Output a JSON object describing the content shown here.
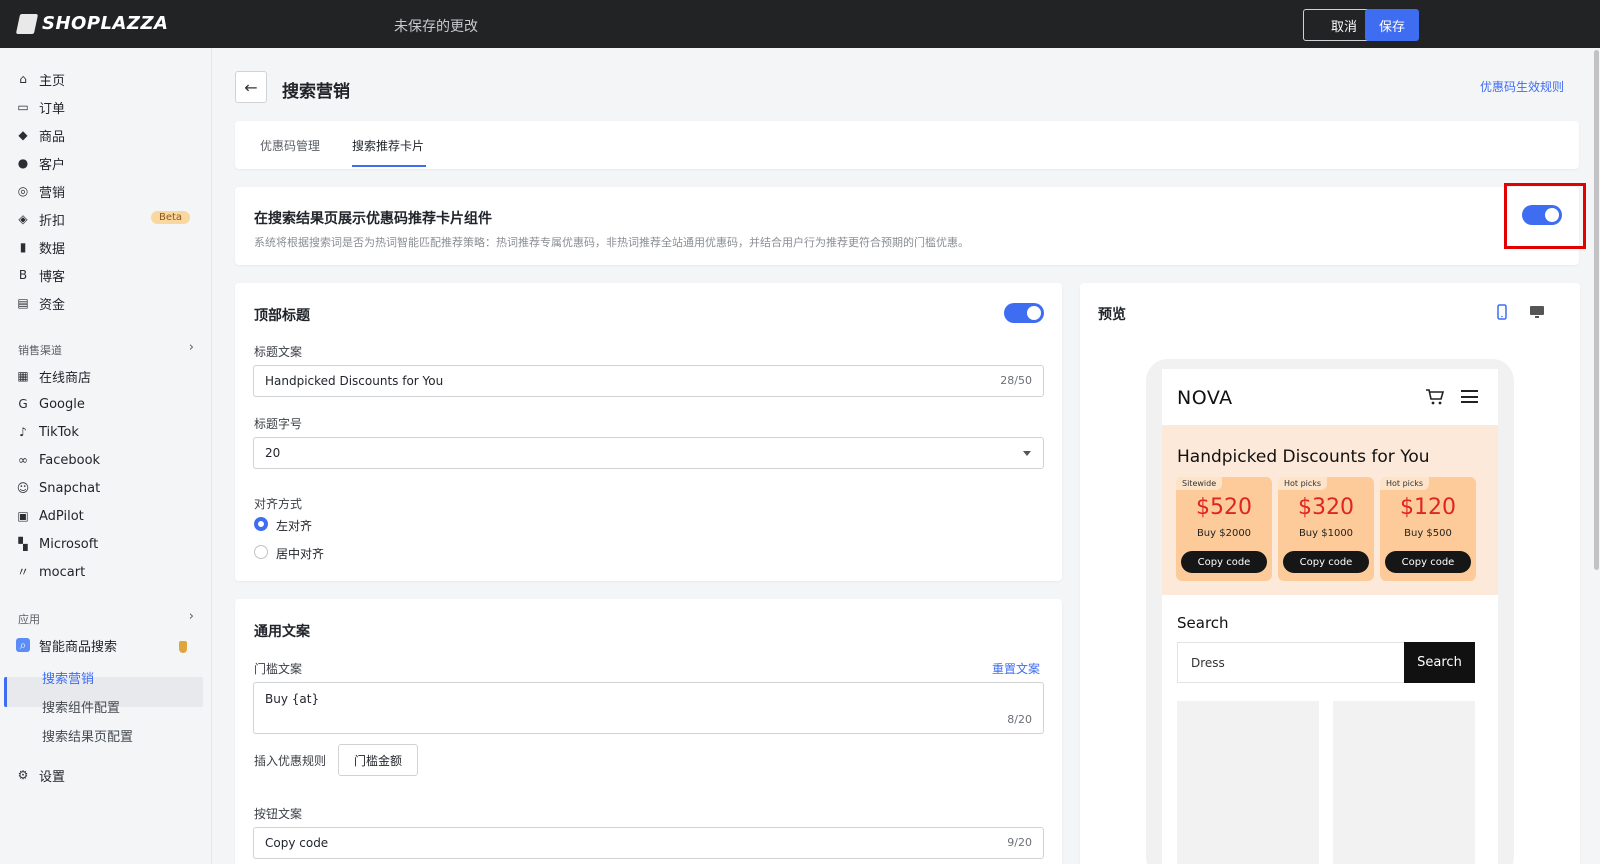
{
  "topbar": {
    "brand": "SHOPLAZZA",
    "unsaved": "未保存的更改",
    "cancel": "取消",
    "save": "保存"
  },
  "sidebar": {
    "items": [
      {
        "label": "主页",
        "icon": "home-icon"
      },
      {
        "label": "订单",
        "icon": "orders-icon"
      },
      {
        "label": "商品",
        "icon": "tag-icon"
      },
      {
        "label": "客户",
        "icon": "user-icon"
      },
      {
        "label": "营销",
        "icon": "marketing-icon"
      },
      {
        "label": "折扣",
        "icon": "discount-icon"
      },
      {
        "label": "数据",
        "icon": "chart-icon"
      },
      {
        "label": "博客",
        "icon": "blog-icon"
      },
      {
        "label": "资金",
        "icon": "wallet-icon"
      }
    ],
    "beta": "Beta",
    "channels_label": "销售渠道",
    "channels": [
      {
        "label": "在线商店",
        "icon": "store-icon"
      },
      {
        "label": "Google",
        "icon": "google-icon"
      },
      {
        "label": "TikTok",
        "icon": "tiktok-icon"
      },
      {
        "label": "Facebook",
        "icon": "facebook-icon"
      },
      {
        "label": "Snapchat",
        "icon": "snapchat-icon"
      },
      {
        "label": "AdPilot",
        "icon": "adpilot-icon"
      },
      {
        "label": "Microsoft",
        "icon": "microsoft-icon"
      },
      {
        "label": "mocart",
        "icon": "mocart-icon"
      }
    ],
    "apps_label": "应用",
    "app": "智能商品搜索",
    "app_sub": [
      "搜索营销",
      "搜索组件配置",
      "搜索结果页配置"
    ],
    "settings": "设置"
  },
  "page": {
    "title": "搜索营销",
    "rule_link": "优惠码生效规则"
  },
  "tabs": [
    {
      "label": "优惠码管理"
    },
    {
      "label": "搜索推荐卡片"
    }
  ],
  "toggle_section": {
    "title": "在搜索结果页展示优惠码推荐卡片组件",
    "desc": "系统将根据搜索词是否为热词智能匹配推荐策略：热词推荐专属优惠码，非热词推荐全站通用优惠码，并结合用户行为推荐更符合预期的门槛优惠。",
    "enabled": true
  },
  "top_title": {
    "heading": "顶部标题",
    "text_label": "标题文案",
    "text_value": "Handpicked Discounts for You",
    "text_count": "28/50",
    "size_label": "标题字号",
    "size_value": "20",
    "align_label": "对齐方式",
    "align_left": "左对齐",
    "align_center": "居中对齐"
  },
  "copy": {
    "heading": "通用文案",
    "threshold_label": "门槛文案",
    "reset": "重置文案",
    "threshold_value": "Buy {at}",
    "threshold_count": "8/20",
    "insert_label": "插入优惠规则",
    "insert_btn": "门槛金额",
    "button_label": "按钮文案",
    "button_value": "Copy code",
    "button_count": "9/20"
  },
  "preview": {
    "title": "预览",
    "brand": "NOVA",
    "promo_title": "Handpicked Discounts for You",
    "coupons": [
      {
        "tag": "Sitewide",
        "amount": "$520",
        "cond": "Buy $2000",
        "btn": "Copy code"
      },
      {
        "tag": "Hot picks",
        "amount": "$320",
        "cond": "Buy $1000",
        "btn": "Copy code"
      },
      {
        "tag": "Hot picks",
        "amount": "$120",
        "cond": "Buy $500",
        "btn": "Copy code"
      }
    ],
    "search_label": "Search",
    "search_value": "Dress",
    "search_btn": "Search"
  },
  "colors": {
    "accent": "#3f6df2",
    "topbar": "#222324",
    "highlight": "#e30000",
    "coupon": "#fdcb9a",
    "price": "#e02424"
  }
}
